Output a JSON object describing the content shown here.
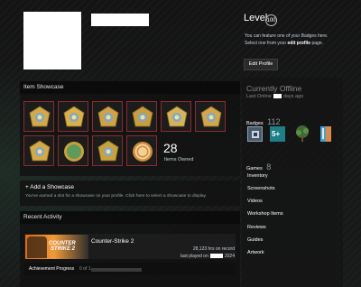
{
  "header": {
    "level_label": "Level",
    "level_value": "100",
    "feature_text_1": "You can feature one of your Badges here.",
    "feature_text_2_pre": "Select one from your ",
    "feature_text_2_link": "edit profile",
    "feature_text_2_post": " page.",
    "edit_profile": "Edit Profile"
  },
  "item_showcase": {
    "title": "Item Showcase",
    "items_count": "28",
    "items_owned_label": "Items Owned"
  },
  "add_showcase": {
    "title": "+ Add a Showcase",
    "desc": "You've earned a slot for a showcase on your profile. Click here to select a showcase to display."
  },
  "recent_activity": {
    "title": "Recent Activity",
    "game_name": "Counter-Strike 2",
    "game_logo_line1": "COUNTER",
    "game_logo_line2": "STRIKE 2",
    "hours": "28,123 hrs on record",
    "last_played_pre": "last played on",
    "last_played_year": "2024",
    "achievement_label": "Achievement Progress",
    "achievement_value": "0 of 1"
  },
  "sidebar": {
    "status": "Currently Offline",
    "last_online_pre": "Last Online",
    "last_online_post": "days ago",
    "badges_label": "Badges",
    "badges_count": "112",
    "badge_level_text": "5+",
    "games_label": "Games",
    "games_count": "8",
    "links": [
      "Inventory",
      "Screenshots",
      "Videos",
      "Workshop Items",
      "Reviews",
      "Guides",
      "Artwork"
    ]
  },
  "colors": {
    "showcase_border": "#8c2b2b",
    "accent_teal": "#2a9aa0",
    "game_orange": "#e07a20"
  }
}
